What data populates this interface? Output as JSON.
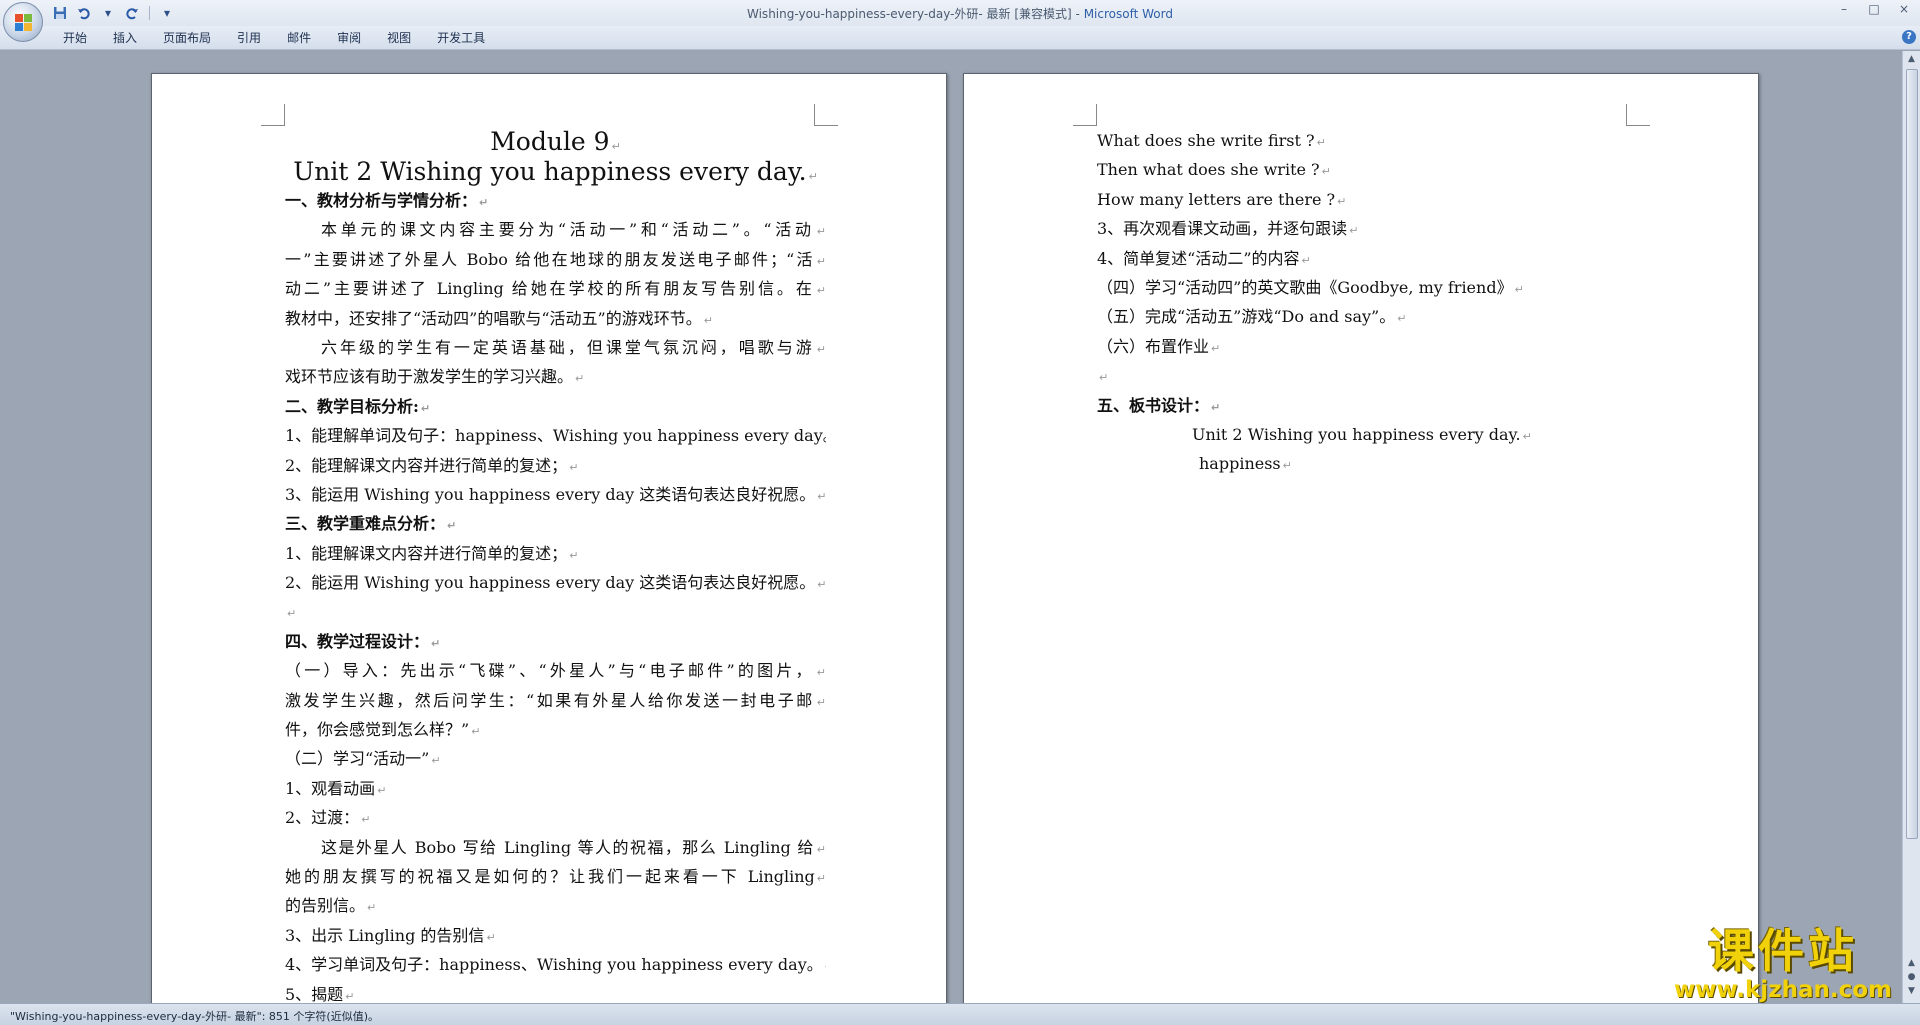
{
  "window": {
    "title_doc": "Wishing-you-happiness-every-day-外研- 最新 [兼容模式] - ",
    "title_app": "Microsoft Word",
    "minimize": "–",
    "maximize": "□",
    "close": "×"
  },
  "qat": {
    "save": "save-icon",
    "undo": "undo-icon",
    "redo": "redo-icon",
    "more": "▾"
  },
  "ribbon": {
    "tabs": [
      "开始",
      "插入",
      "页面布局",
      "引用",
      "邮件",
      "审阅",
      "视图",
      "开发工具"
    ],
    "help": "?"
  },
  "pages": {
    "left": [
      {
        "text": "Module 9",
        "cls": "title1"
      },
      {
        "text": "Unit 2    Wishing you happiness every day.",
        "cls": "title2"
      },
      {
        "text": "一、教材分析与学情分析：",
        "cls": "h"
      },
      {
        "text": "本单元的课文内容主要分为“活动一”和“活动二”。“活动",
        "cls": "ind just"
      },
      {
        "text": "一”主要讲述了外星人 Bobo 给他在地球的朋友发送电子邮件；“活",
        "cls": "just"
      },
      {
        "text": "动二”主要讲述了 Lingling 给她在学校的所有朋友写告别信。在",
        "cls": "just"
      },
      {
        "text": "教材中，还安排了“活动四”的唱歌与“活动五”的游戏环节。",
        "cls": ""
      },
      {
        "text": "六年级的学生有一定英语基础，但课堂气氛沉闷，唱歌与游",
        "cls": "ind just"
      },
      {
        "text": "戏环节应该有助于激发学生的学习兴趣。",
        "cls": ""
      },
      {
        "text": "二、教学目标分析:",
        "cls": "h"
      },
      {
        "text": "1、能理解单词及句子：happiness、Wishing you happiness every day。",
        "cls": ""
      },
      {
        "text": "2、能理解课文内容并进行简单的复述；",
        "cls": ""
      },
      {
        "text": "3、能运用 Wishing you happiness every day 这类语句表达良好祝愿。",
        "cls": ""
      },
      {
        "text": "三、教学重难点分析：",
        "cls": "h"
      },
      {
        "text": "1、能理解课文内容并进行简单的复述；",
        "cls": ""
      },
      {
        "text": "2、能运用 Wishing you happiness every day 这类语句表达良好祝愿。",
        "cls": ""
      },
      {
        "text": "",
        "cls": ""
      },
      {
        "text": "四、教学过程设计：",
        "cls": "h"
      },
      {
        "text": "（一）导入：先出示“飞碟”、“外星人”与“电子邮件”的图片，",
        "cls": "just"
      },
      {
        "text": "激发学生兴趣，然后问学生：“如果有外星人给你发送一封电子邮",
        "cls": "just"
      },
      {
        "text": "件，你会感觉到怎么样？”",
        "cls": ""
      },
      {
        "text": "（二）学习“活动一”",
        "cls": ""
      },
      {
        "text": "1、观看动画",
        "cls": ""
      },
      {
        "text": "2、过渡：",
        "cls": ""
      },
      {
        "text": "这是外星人 Bobo 写给 Lingling 等人的祝福，那么 Lingling 给",
        "cls": "ind just"
      },
      {
        "text": "她的朋友撰写的祝福又是如何的？让我们一起来看一下 Lingling",
        "cls": "just"
      },
      {
        "text": "的告别信。",
        "cls": ""
      },
      {
        "text": "3、出示 Lingling 的告别信",
        "cls": ""
      },
      {
        "text": "4、学习单词及句子：happiness、Wishing you happiness every day。",
        "cls": ""
      },
      {
        "text": "5、揭题",
        "cls": ""
      }
    ],
    "right": [
      {
        "text": "What  does  she  write  first ?",
        "cls": ""
      },
      {
        "text": "Then  what  does  she  write ?",
        "cls": ""
      },
      {
        "text": "How  many  letters  are  there ?",
        "cls": ""
      },
      {
        "text": "3、再次观看课文动画，并逐句跟读",
        "cls": ""
      },
      {
        "text": "4、简单复述“活动二”的内容",
        "cls": ""
      },
      {
        "text": "（四）学习“活动四”的英文歌曲《Goodbye,  my  friend》",
        "cls": ""
      },
      {
        "text": "（五）完成“活动五”游戏“Do  and  say”。",
        "cls": ""
      },
      {
        "text": "（六）布置作业",
        "cls": ""
      },
      {
        "text": "",
        "cls": ""
      },
      {
        "text": "五、板书设计：",
        "cls": "h"
      },
      {
        "text": "Unit 2    Wishing you happiness every day.",
        "cls": "center1"
      },
      {
        "text": "happiness",
        "cls": "center2"
      }
    ]
  },
  "status": {
    "text": "\"Wishing-you-happiness-every-day-外研- 最新\": 851 个字符(近似值)。"
  },
  "watermark": {
    "title": "课件站",
    "url": "www.kjzhan.com"
  },
  "colors": {
    "accent": "#2f5fa8",
    "watermark": "#f1d20a"
  }
}
